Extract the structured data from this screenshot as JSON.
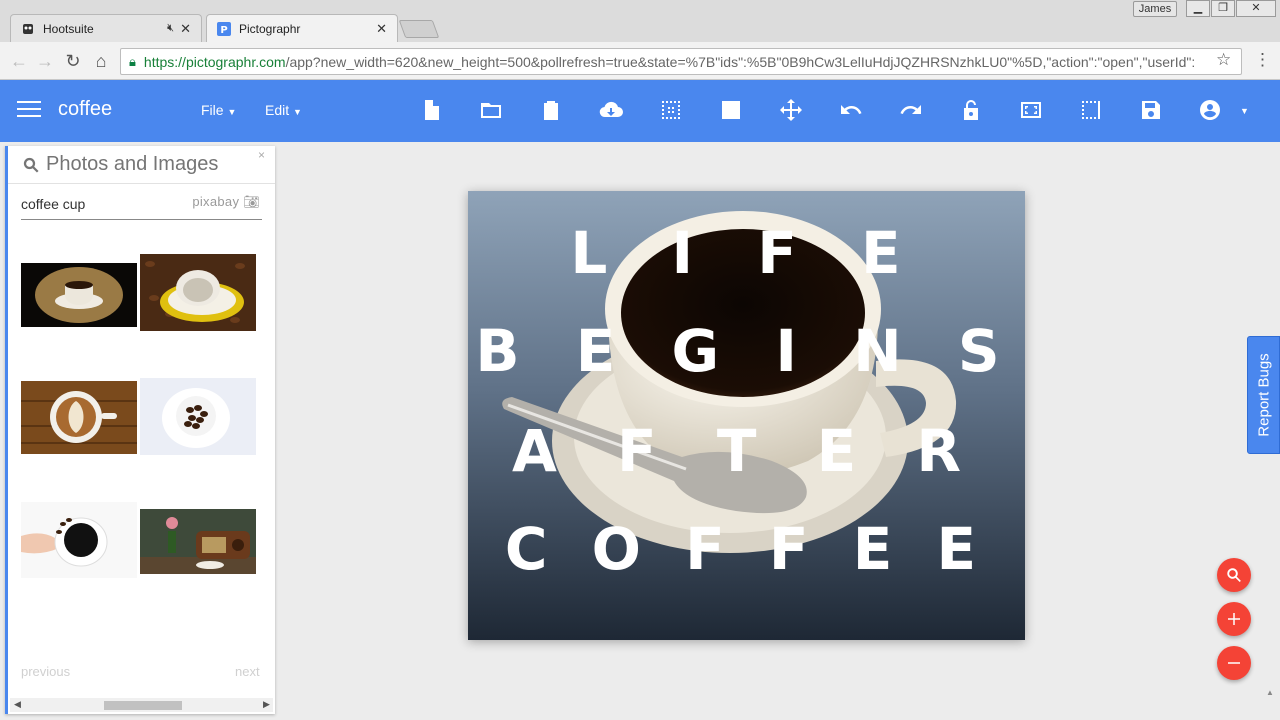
{
  "browser": {
    "tabs": [
      {
        "title": "Hootsuite",
        "favicon": "owl-icon",
        "audio": "muted-icon"
      },
      {
        "title": "Pictographr",
        "favicon": "P"
      }
    ],
    "profile_name": "James",
    "url_host": "https://pictographr.com",
    "url_path": "/app?new_width=620&new_height=500&pollrefresh=true&state=%7B\"ids\":%5B\"0B9hCw3LelIuHdjJQZHRSNzhkLU0\"%5D,\"action\":\"open\",\"userId\":"
  },
  "app": {
    "document_title": "coffee",
    "menus": {
      "file": "File",
      "edit": "Edit"
    },
    "accent_color": "#4a87ee",
    "tools": [
      "new-file-icon",
      "open-folder-icon",
      "clipboard-icon",
      "cloud-download-icon",
      "grid-select-icon",
      "image-icon",
      "move-icon",
      "undo-icon",
      "redo-icon",
      "lock-icon",
      "fit-screen-icon",
      "crop-icon",
      "save-icon",
      "account-icon"
    ]
  },
  "panel": {
    "title": "Photos and Images",
    "close": "×",
    "query": "coffee cup",
    "source": "pixabay",
    "results": [
      {
        "name": "espresso-cup-dark"
      },
      {
        "name": "cup-on-coffee-beans"
      },
      {
        "name": "latte-art-wood"
      },
      {
        "name": "cup-of-coffee-beans"
      },
      {
        "name": "hand-holding-coffee"
      },
      {
        "name": "vintage-radio-coffee"
      }
    ],
    "previous": "previous",
    "next": "next"
  },
  "canvas": {
    "lines": [
      "L I F E",
      "B E G I N S",
      "A F T E R",
      "C O F F E E"
    ]
  },
  "report_bugs": "Report Bugs",
  "fab_color": "#f44336"
}
